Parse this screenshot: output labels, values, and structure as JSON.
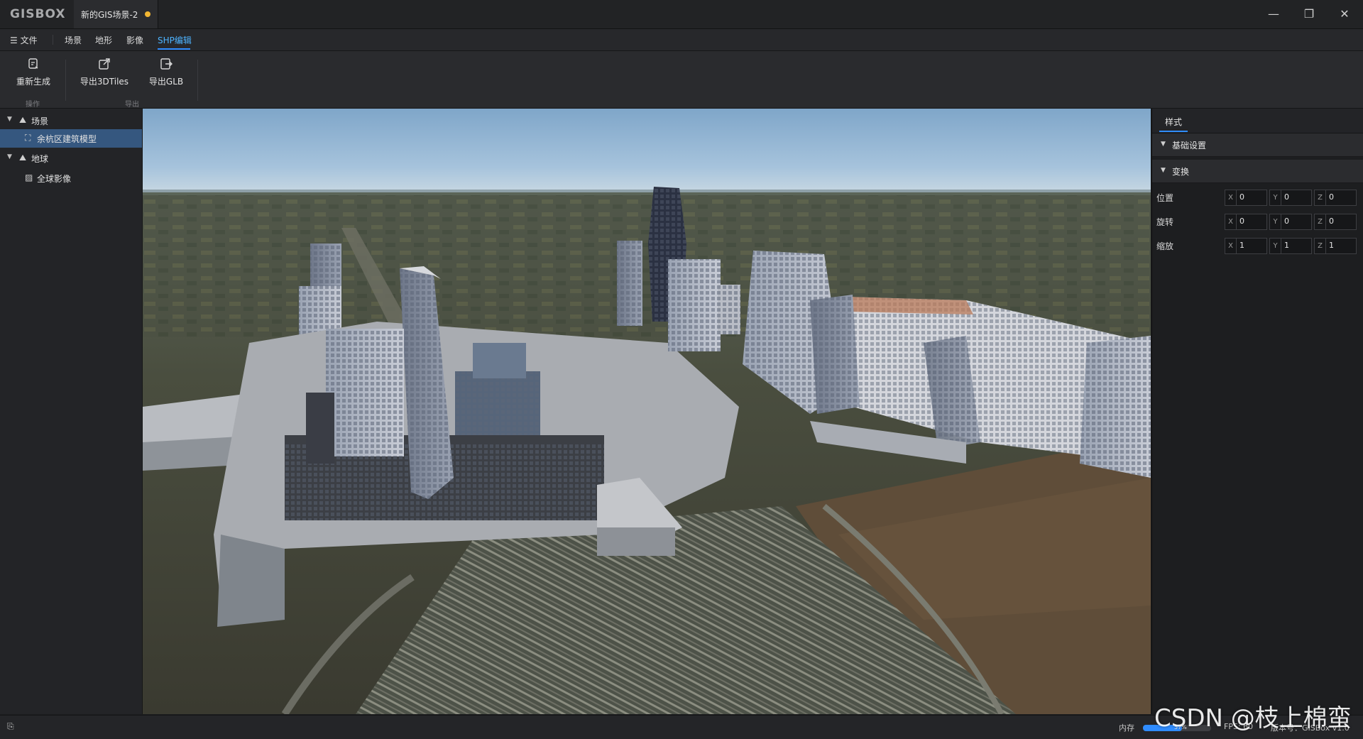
{
  "app": {
    "logo_text": "GISBOX",
    "tab_title": "新的GIS场景-2",
    "unsaved_color": "#f2b632",
    "accent_color": "#2f8cff",
    "window_controls": {
      "minimize": "—",
      "restore": "❐",
      "close": "✕"
    }
  },
  "menubar": {
    "file_label": "文件",
    "items": [
      "场景",
      "地形",
      "影像",
      "SHP编辑"
    ],
    "active": "SHP编辑"
  },
  "toolbar": {
    "groups": [
      {
        "label": "操作",
        "tools": [
          {
            "label": "重新生成",
            "icon": "regenerate-icon"
          }
        ]
      },
      {
        "label": "导出",
        "tools": [
          {
            "label": "导出3DTiles",
            "icon": "export-icon"
          },
          {
            "label": "导出GLB",
            "icon": "export-glb-icon"
          }
        ]
      }
    ]
  },
  "scene_tree": [
    {
      "label": "场景",
      "icon": "layers-icon",
      "expanded": true,
      "children": [
        {
          "label": "余杭区建筑模型",
          "icon": "model-icon",
          "selected": true
        }
      ]
    },
    {
      "label": "地球",
      "icon": "layers-icon",
      "expanded": true,
      "children": [
        {
          "label": "全球影像",
          "icon": "imagery-icon",
          "selected": false
        }
      ]
    }
  ],
  "properties": {
    "tab": "样式",
    "sections": [
      {
        "label": "基础设置"
      },
      {
        "label": "变换"
      }
    ],
    "transform": [
      {
        "label": "位置",
        "x": "0",
        "y": "0",
        "z": "0"
      },
      {
        "label": "旋转",
        "x": "0",
        "y": "0",
        "z": "0"
      },
      {
        "label": "缩放",
        "x": "1",
        "y": "1",
        "z": "1"
      }
    ]
  },
  "status": {
    "memory_label": "内存",
    "memory_percent_text": "57%",
    "memory_fraction": 0.57,
    "fps_text": "FPS: 60",
    "version_text": "版本号：GISBox v1.0",
    "watermark": "CSDN @枝上棉蛮"
  }
}
